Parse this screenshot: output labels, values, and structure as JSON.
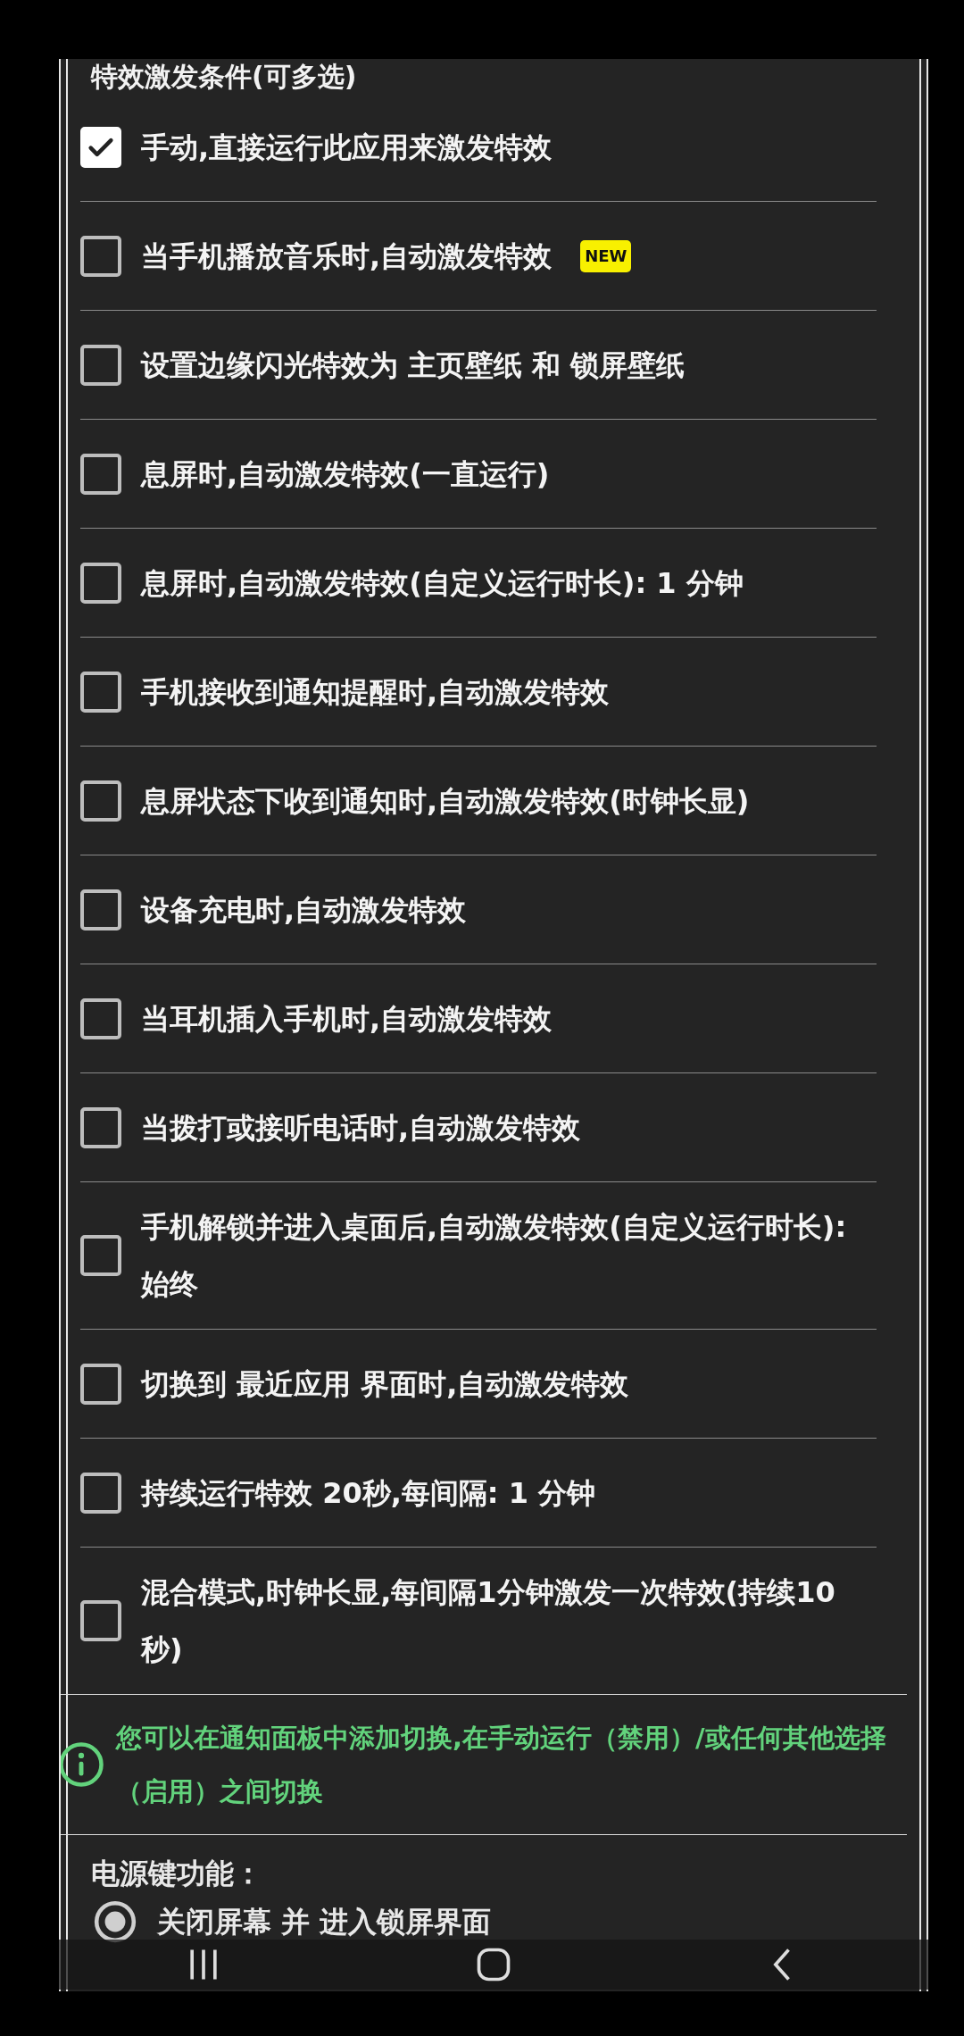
{
  "section_title": "特效激发条件(可多选)",
  "options": [
    {
      "label": "手动,直接运行此应用来激发特效",
      "checked": true
    },
    {
      "label": "当手机播放音乐时,自动激发特效",
      "checked": false,
      "badge": "NEW"
    },
    {
      "label": "设置边缘闪光特效为 主页壁纸 和 锁屏壁纸",
      "checked": false
    },
    {
      "label": "息屏时,自动激发特效(一直运行)",
      "checked": false
    },
    {
      "label": "息屏时,自动激发特效(自定义运行时长): 1 分钟",
      "checked": false
    },
    {
      "label": "手机接收到通知提醒时,自动激发特效",
      "checked": false
    },
    {
      "label": "息屏状态下收到通知时,自动激发特效(时钟长显)",
      "checked": false
    },
    {
      "label": "设备充电时,自动激发特效",
      "checked": false
    },
    {
      "label": "当耳机插入手机时,自动激发特效",
      "checked": false
    },
    {
      "label": "当拨打或接听电话时,自动激发特效",
      "checked": false
    },
    {
      "label": "手机解锁并进入桌面后,自动激发特效(自定义运行时长): 始终",
      "checked": false
    },
    {
      "label": "切换到 最近应用 界面时,自动激发特效",
      "checked": false
    },
    {
      "label": "持续运行特效 20秒,每间隔: 1 分钟",
      "checked": false
    },
    {
      "label": "混合模式,时钟长显,每间隔1分钟激发一次特效(持续10秒)",
      "checked": false
    }
  ],
  "info": {
    "text": "您可以在通知面板中添加切换,在手动运行（禁用）/或任何其他选择（启用）之间切换"
  },
  "power_key": {
    "title": "电源键功能：",
    "options": [
      {
        "label": "关闭屏幕 并 进入锁屏界面",
        "selected": true
      }
    ]
  }
}
